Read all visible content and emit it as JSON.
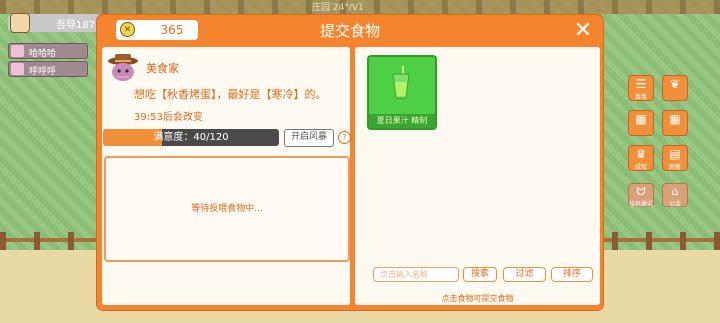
{
  "hud": {
    "top_bar_text": "吾导187",
    "background_text": "庄园 24°/V1",
    "players": [
      {
        "name": "哈哈哈"
      },
      {
        "name": "呼呼呼"
      }
    ],
    "side_buttons": [
      {
        "label": "菜单",
        "icon": "menu-icon"
      },
      {
        "label": "成就",
        "icon": "trophy-icon"
      },
      {
        "label": "图鉴",
        "icon": "book-icon"
      },
      {
        "label": "挂机模式",
        "icon": "cat-icon"
      },
      {
        "label": "公会",
        "icon": "house-icon"
      }
    ]
  },
  "dialog": {
    "title": "提交食物",
    "coins": "365",
    "customer": {
      "name": "美食家",
      "request": "想吃【秋香烤蛋】，最好是【寒冷】的。",
      "change_timer": "39:53后会改变"
    },
    "satisfaction": {
      "label": "满意度：40/120",
      "current": 40,
      "max": 120
    },
    "storm_button": "开启风暴",
    "help_glyph": "?",
    "drop_zone_text": "等待投喂食物中...",
    "foods": [
      {
        "name": "夏日果汁 精制",
        "color": "#4fcf45"
      }
    ],
    "search": {
      "placeholder": "点击输入名称",
      "search_btn": "搜索",
      "filter_btn": "过滤",
      "sort_btn": "排序"
    },
    "hint": "点击食物可提交食物"
  },
  "colors": {
    "dialog_orange": "#f4852e",
    "panel_bg": "#fffaf1",
    "accent_text": "#e06a1f",
    "food_green": "#4fcf45"
  }
}
